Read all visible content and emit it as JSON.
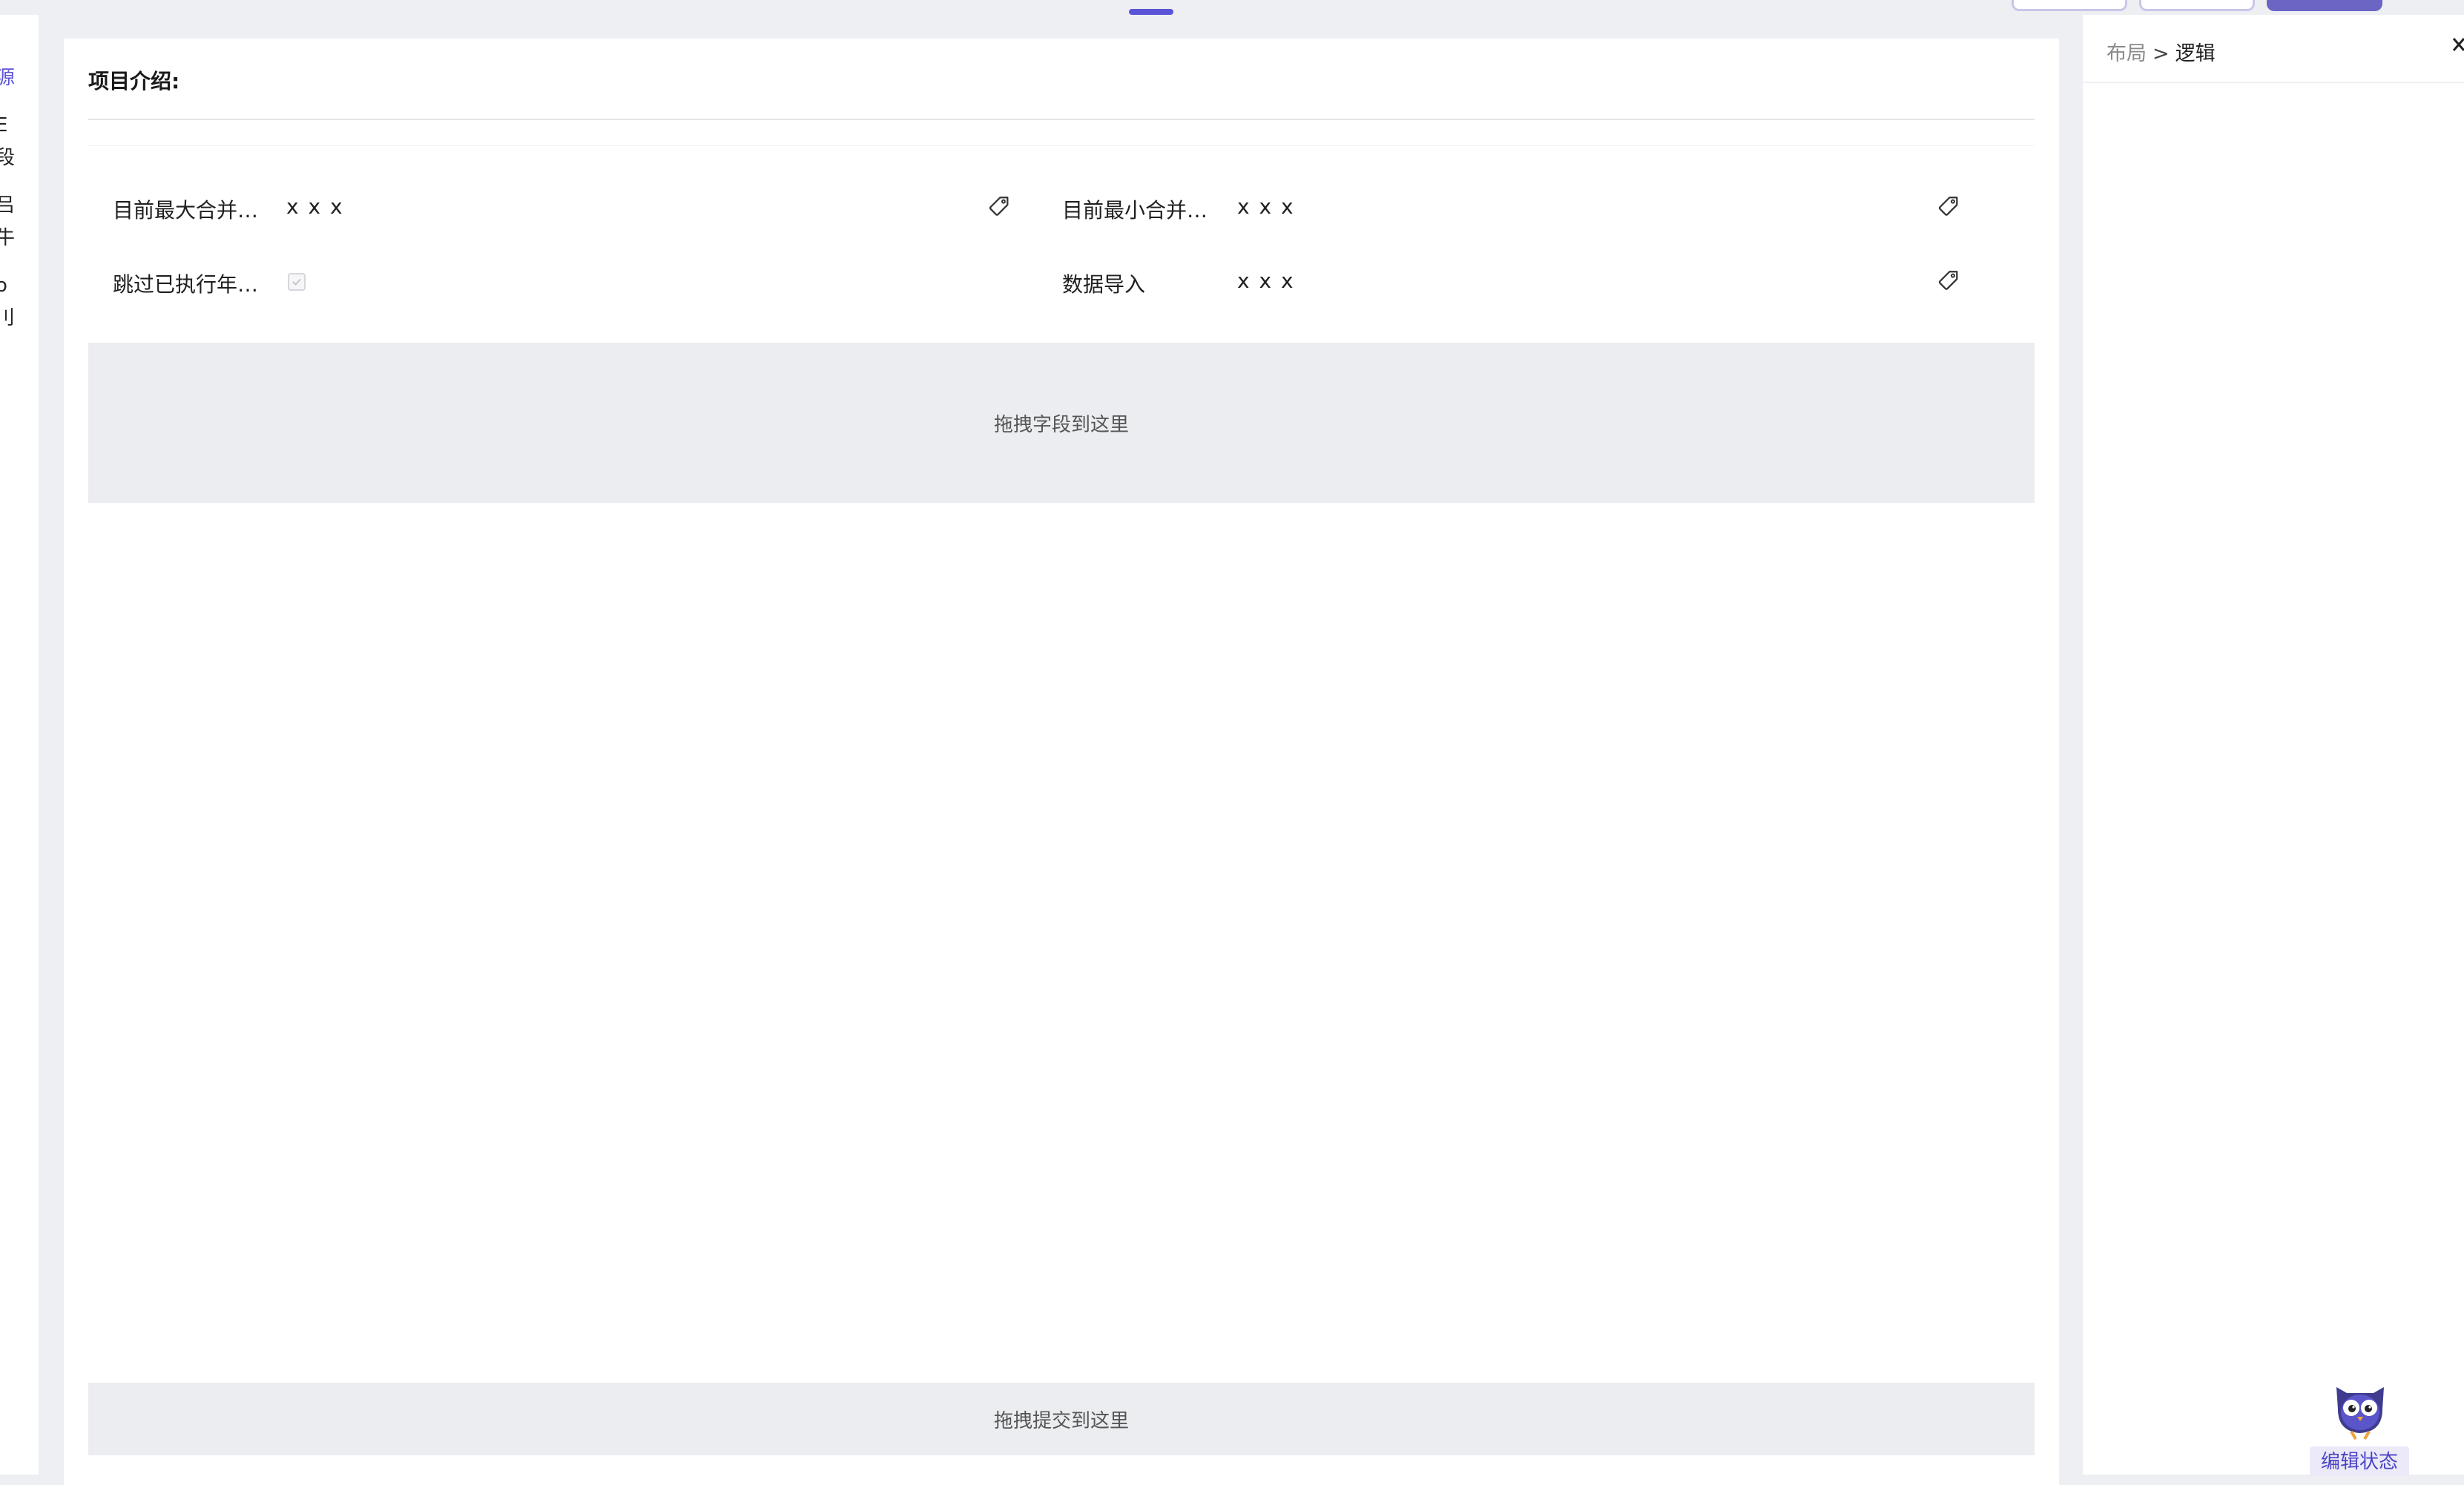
{
  "left_sidebar": {
    "chars": [
      {
        "text": "源",
        "active": true
      },
      {
        "text": "E",
        "active": false
      },
      {
        "text": "段",
        "active": false
      },
      {
        "text": "吕",
        "active": false
      },
      {
        "text": "牛",
        "active": false
      },
      {
        "text": "o",
        "active": false
      },
      {
        "text": "刂",
        "active": false
      }
    ]
  },
  "form": {
    "title": "项目介绍:",
    "fields": [
      {
        "label": "目前最大合并…",
        "value": "x x x"
      },
      {
        "label": "目前最小合并…",
        "value": "x x x"
      },
      {
        "label": "跳过已执行年…",
        "value": "",
        "checked": true
      },
      {
        "label": "数据导入",
        "value": "x x x"
      }
    ],
    "drop_fields_text": "拖拽字段到这里",
    "drop_submit_text": "拖拽提交到这里"
  },
  "right_panel": {
    "breadcrumb": {
      "parent": "布局",
      "separator": ">",
      "current": "逻辑"
    },
    "edit_status_label": "编辑状态"
  },
  "colors": {
    "accent": "#5b54d6",
    "drop_zone": "#ecedf1",
    "background": "#eeeff3"
  }
}
